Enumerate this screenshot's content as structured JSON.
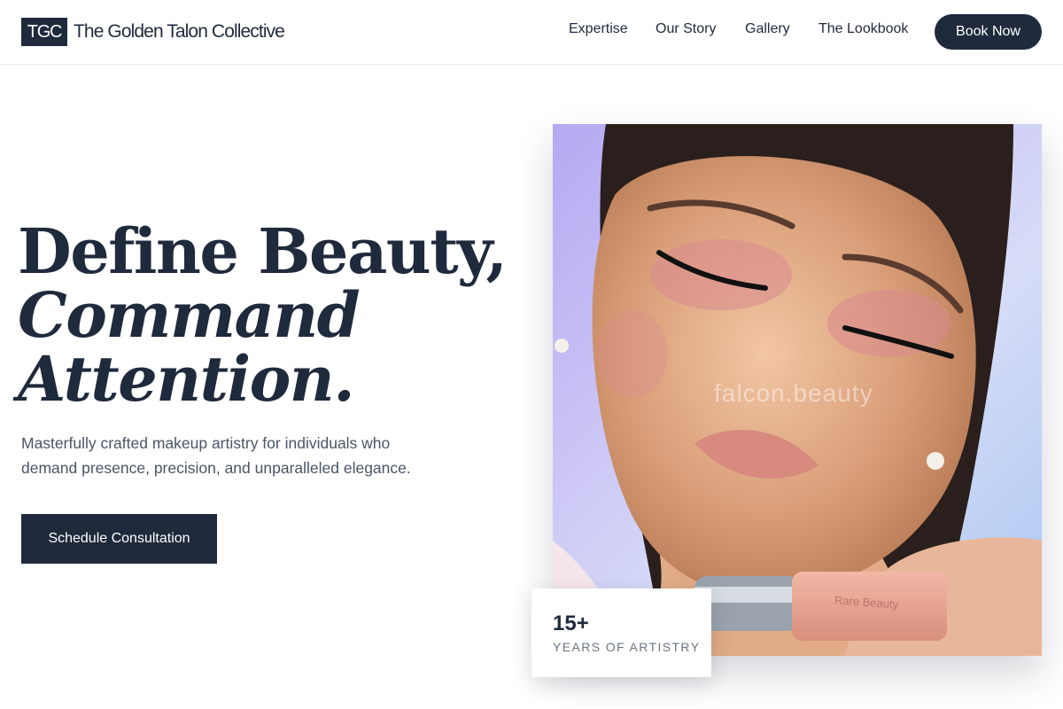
{
  "brand": {
    "mark": "TGC",
    "name": "The Golden Talon Collective"
  },
  "nav": {
    "items": [
      "Expertise",
      "Our Story",
      "Gallery",
      "The Lookbook"
    ],
    "book_label": "Book Now"
  },
  "hero": {
    "headline_line1": "Define Beauty,",
    "headline_line2": "Command",
    "headline_line3": "Attention.",
    "subtext": "Masterfully crafted makeup artistry for individuals who demand presence, precision, and unparalleled elegance.",
    "cta_label": "Schedule Consultation",
    "image_watermark": "falcon.beauty",
    "product_label": "Rare Beauty"
  },
  "stat": {
    "value": "15+",
    "label": "YEARS OF ARTISTRY"
  },
  "colors": {
    "primary": "#1f2a3c",
    "text_muted": "#4a5566",
    "label_gray": "#6b7585",
    "background": "#ffffff"
  }
}
